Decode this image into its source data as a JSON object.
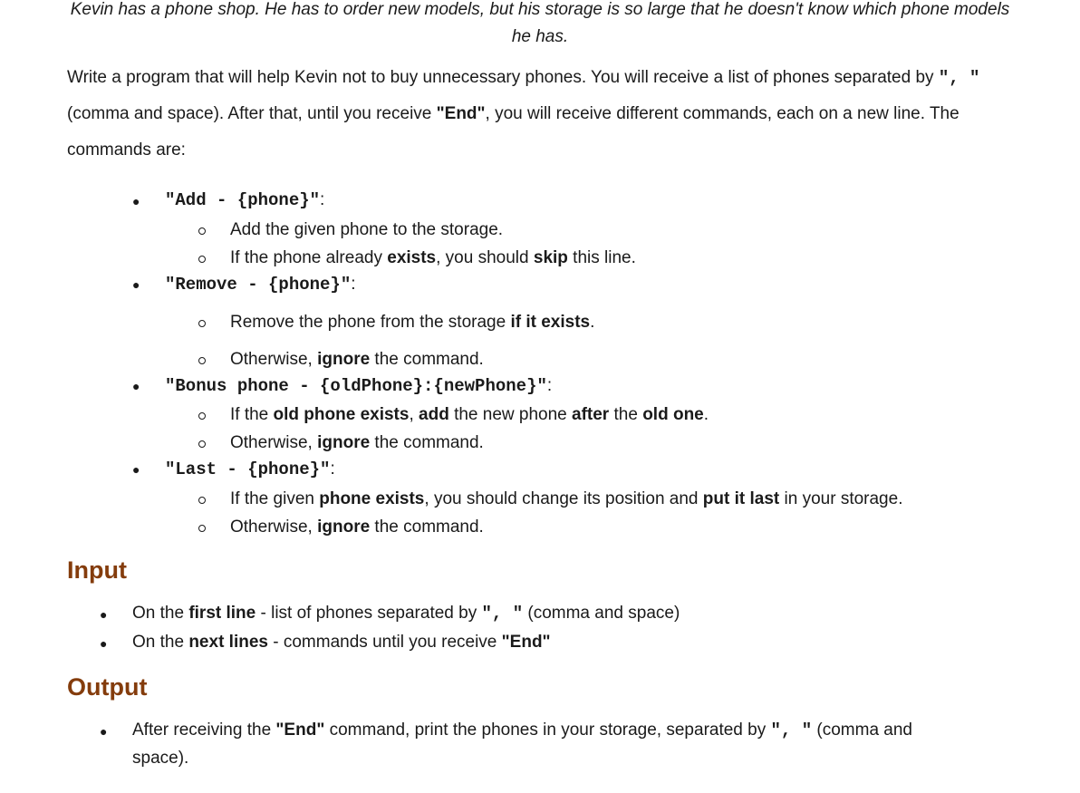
{
  "intro": "Kevin has a phone shop. He has to order new models, but his storage is so large that he doesn't know which phone models he has.",
  "para": {
    "p1": "Write a program that will help Kevin not to buy unnecessary phones. You will receive a list of phones separated by ",
    "sep": "\",  \"",
    "p2": " (comma and space). After that, until you receive ",
    "end": "\"End\"",
    "p3": ", you will receive different commands, each on a new line. The commands are:"
  },
  "commands": [
    {
      "cmd": "\"Add - {phone}\"",
      "colon": ":",
      "subs": [
        {
          "parts": [
            "Add the given phone to the storage."
          ],
          "bold": [
            false
          ]
        },
        {
          "parts": [
            "If the phone already ",
            "exists",
            ", you should ",
            "skip",
            " this line."
          ],
          "bold": [
            false,
            true,
            false,
            true,
            false
          ]
        }
      ]
    },
    {
      "cmd": "\"Remove - {phone}\"",
      "colon": ":",
      "subs": [
        {
          "parts": [
            "Remove the phone from the storage ",
            "if it exists",
            "."
          ],
          "bold": [
            false,
            true,
            false
          ]
        },
        {
          "parts": [
            "Otherwise, ",
            "ignore",
            " the command."
          ],
          "bold": [
            false,
            true,
            false
          ]
        }
      ]
    },
    {
      "cmd": "\"Bonus phone - {oldPhone}:{newPhone}\"",
      "colon": ":",
      "subs": [
        {
          "parts": [
            "If the ",
            "old phone exists",
            ", ",
            "add",
            " the new phone ",
            "after",
            " the ",
            "old one",
            "."
          ],
          "bold": [
            false,
            true,
            false,
            true,
            false,
            true,
            false,
            true,
            false
          ]
        },
        {
          "parts": [
            "Otherwise, ",
            "ignore",
            " the command."
          ],
          "bold": [
            false,
            true,
            false
          ]
        }
      ]
    },
    {
      "cmd": "\"Last - {phone}\"",
      "colon": ":",
      "subs": [
        {
          "parts": [
            "If the given ",
            "phone exists",
            ", you should change its position and ",
            "put it last",
            " in your storage."
          ],
          "bold": [
            false,
            true,
            false,
            true,
            false
          ]
        },
        {
          "parts": [
            "Otherwise, ",
            "ignore",
            " the command."
          ],
          "bold": [
            false,
            true,
            false
          ]
        }
      ]
    }
  ],
  "input": {
    "heading": "Input",
    "items": [
      {
        "parts": [
          "On the ",
          "first line",
          " - list of phones separated by ",
          "\",  \"",
          " (comma and space)"
        ],
        "bold": [
          false,
          true,
          false,
          true,
          false
        ]
      },
      {
        "parts": [
          "On the ",
          "next lines",
          " - commands until you receive ",
          "\"End\""
        ],
        "bold": [
          false,
          true,
          false,
          true
        ]
      }
    ]
  },
  "output": {
    "heading": "Output",
    "line1": {
      "parts": [
        "After receiving the ",
        "\"End\"",
        " command, print the phones in your storage, separated by ",
        "\",  \"",
        " (comma and"
      ],
      "bold": [
        false,
        true,
        false,
        true,
        false
      ]
    },
    "line2": "space)."
  },
  "colors": {
    "heading": "#843c0c",
    "text": "#1a1a1a"
  }
}
